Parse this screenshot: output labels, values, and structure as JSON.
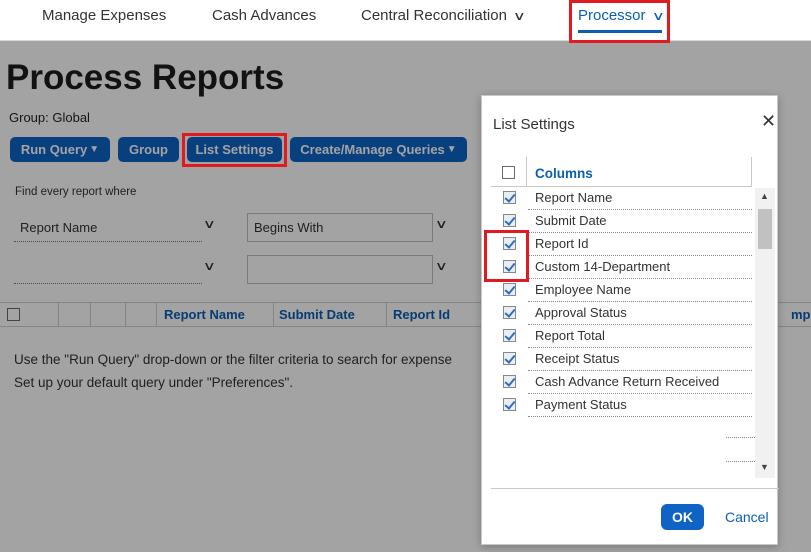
{
  "nav": {
    "items": [
      {
        "label": "Manage Expenses"
      },
      {
        "label": "Cash Advances"
      },
      {
        "label": "Central Reconciliation"
      },
      {
        "label": "Processor"
      }
    ]
  },
  "page": {
    "title": "Process Reports",
    "group": "Group: Global"
  },
  "toolbar": {
    "run_query": "Run Query",
    "group": "Group",
    "list_settings": "List Settings",
    "manage_queries": "Create/Manage Queries"
  },
  "filter": {
    "caption": "Find every report where",
    "field": "Report Name",
    "operator": "Begins With",
    "field2": "",
    "value2": ""
  },
  "grid": {
    "columns": [
      "Report Name",
      "Submit Date",
      "Report Id",
      "mpl"
    ]
  },
  "messages": {
    "line1": "Use the \"Run Query\" drop-down or the filter criteria to search for expense",
    "line2": "Set up your default query under \"Preferences\"."
  },
  "modal": {
    "title": "List Settings",
    "columns_header": "Columns",
    "ok": "OK",
    "cancel": "Cancel",
    "items": [
      {
        "label": "Report Name",
        "checked": true
      },
      {
        "label": "Submit Date",
        "checked": true
      },
      {
        "label": "Report Id",
        "checked": true
      },
      {
        "label": "Custom 14-Department",
        "checked": true
      },
      {
        "label": "Employee Name",
        "checked": true
      },
      {
        "label": "Approval Status",
        "checked": true
      },
      {
        "label": "Report Total",
        "checked": true
      },
      {
        "label": "Receipt Status",
        "checked": true
      },
      {
        "label": "Cash Advance Return Received",
        "checked": true
      },
      {
        "label": "Payment Status",
        "checked": true
      }
    ]
  },
  "colors": {
    "accent": "#0e63c5",
    "link": "#0a5fb4",
    "highlight": "#e11a22"
  }
}
